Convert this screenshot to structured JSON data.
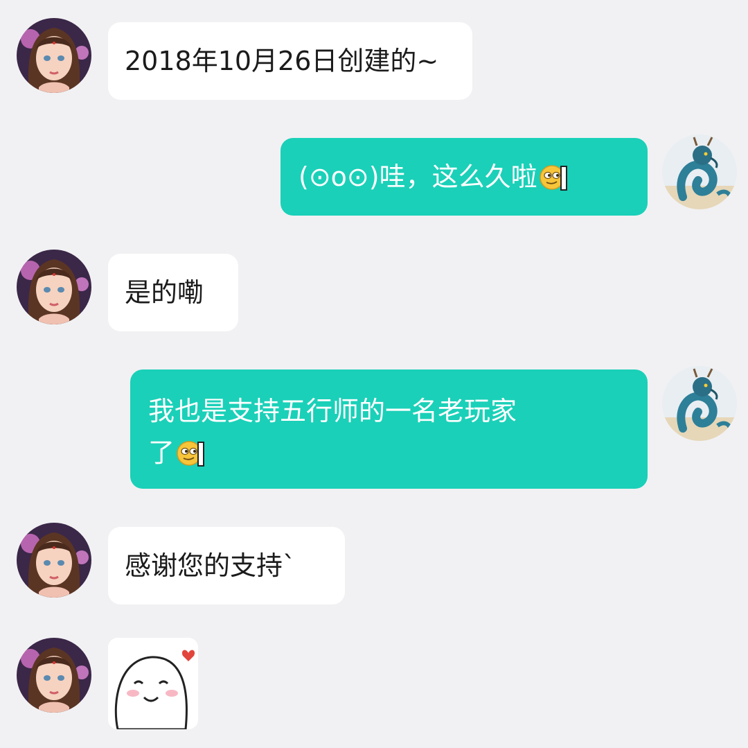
{
  "conversation": {
    "messages": [
      {
        "sender": "other",
        "text": "2018年10月26日创建的~"
      },
      {
        "sender": "me",
        "text": "(⊙o⊙)哇，这么久啦",
        "trailing_emoji": "peeking-face-emoji"
      },
      {
        "sender": "other",
        "text": "是的嘞"
      },
      {
        "sender": "me",
        "text": "我也是支持五行师的一名老玩家\n了",
        "trailing_emoji": "peeking-face-emoji"
      },
      {
        "sender": "other",
        "text": "感谢您的支持`"
      },
      {
        "sender": "other",
        "sticker": "smiling-blob-heart-sticker"
      }
    ]
  },
  "avatars": {
    "other": "fantasy-girl-avatar",
    "me": "blue-dragon-avatar"
  },
  "colors": {
    "background": "#f1f1f3",
    "incoming_bubble": "#ffffff",
    "outgoing_bubble": "#1ad0b8",
    "outgoing_text": "#ffffff",
    "incoming_text": "#1b1b1b"
  }
}
